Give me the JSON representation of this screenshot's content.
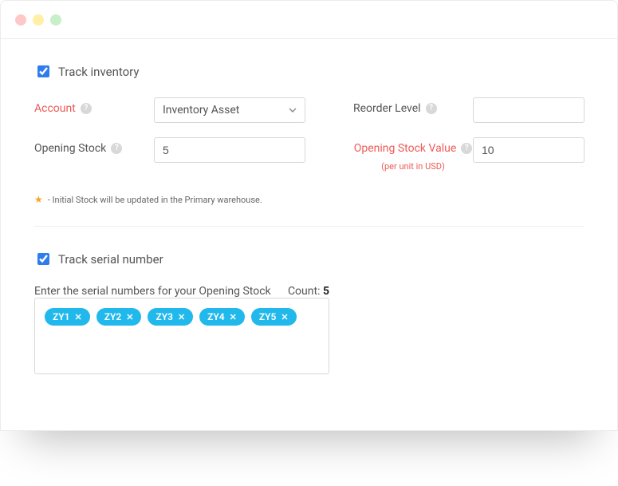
{
  "trackInventory": {
    "label": "Track inventory",
    "checked": true
  },
  "fields": {
    "account": {
      "label": "Account",
      "value": "Inventory Asset"
    },
    "reorderLevel": {
      "label": "Reorder Level",
      "value": ""
    },
    "openingStock": {
      "label": "Opening Stock",
      "value": "5"
    },
    "openingStockValue": {
      "label": "Opening Stock Value",
      "sub": "(per unit in USD)",
      "value": "10"
    }
  },
  "note": "- Initial Stock will be updated in the Primary warehouse.",
  "trackSerial": {
    "label": "Track serial number",
    "checked": true
  },
  "serial": {
    "prompt": "Enter the serial numbers for your Opening Stock",
    "countLabel": "Count:",
    "count": "5",
    "tags": [
      "ZY1",
      "ZY2",
      "ZY3",
      "ZY4",
      "ZY5"
    ]
  }
}
